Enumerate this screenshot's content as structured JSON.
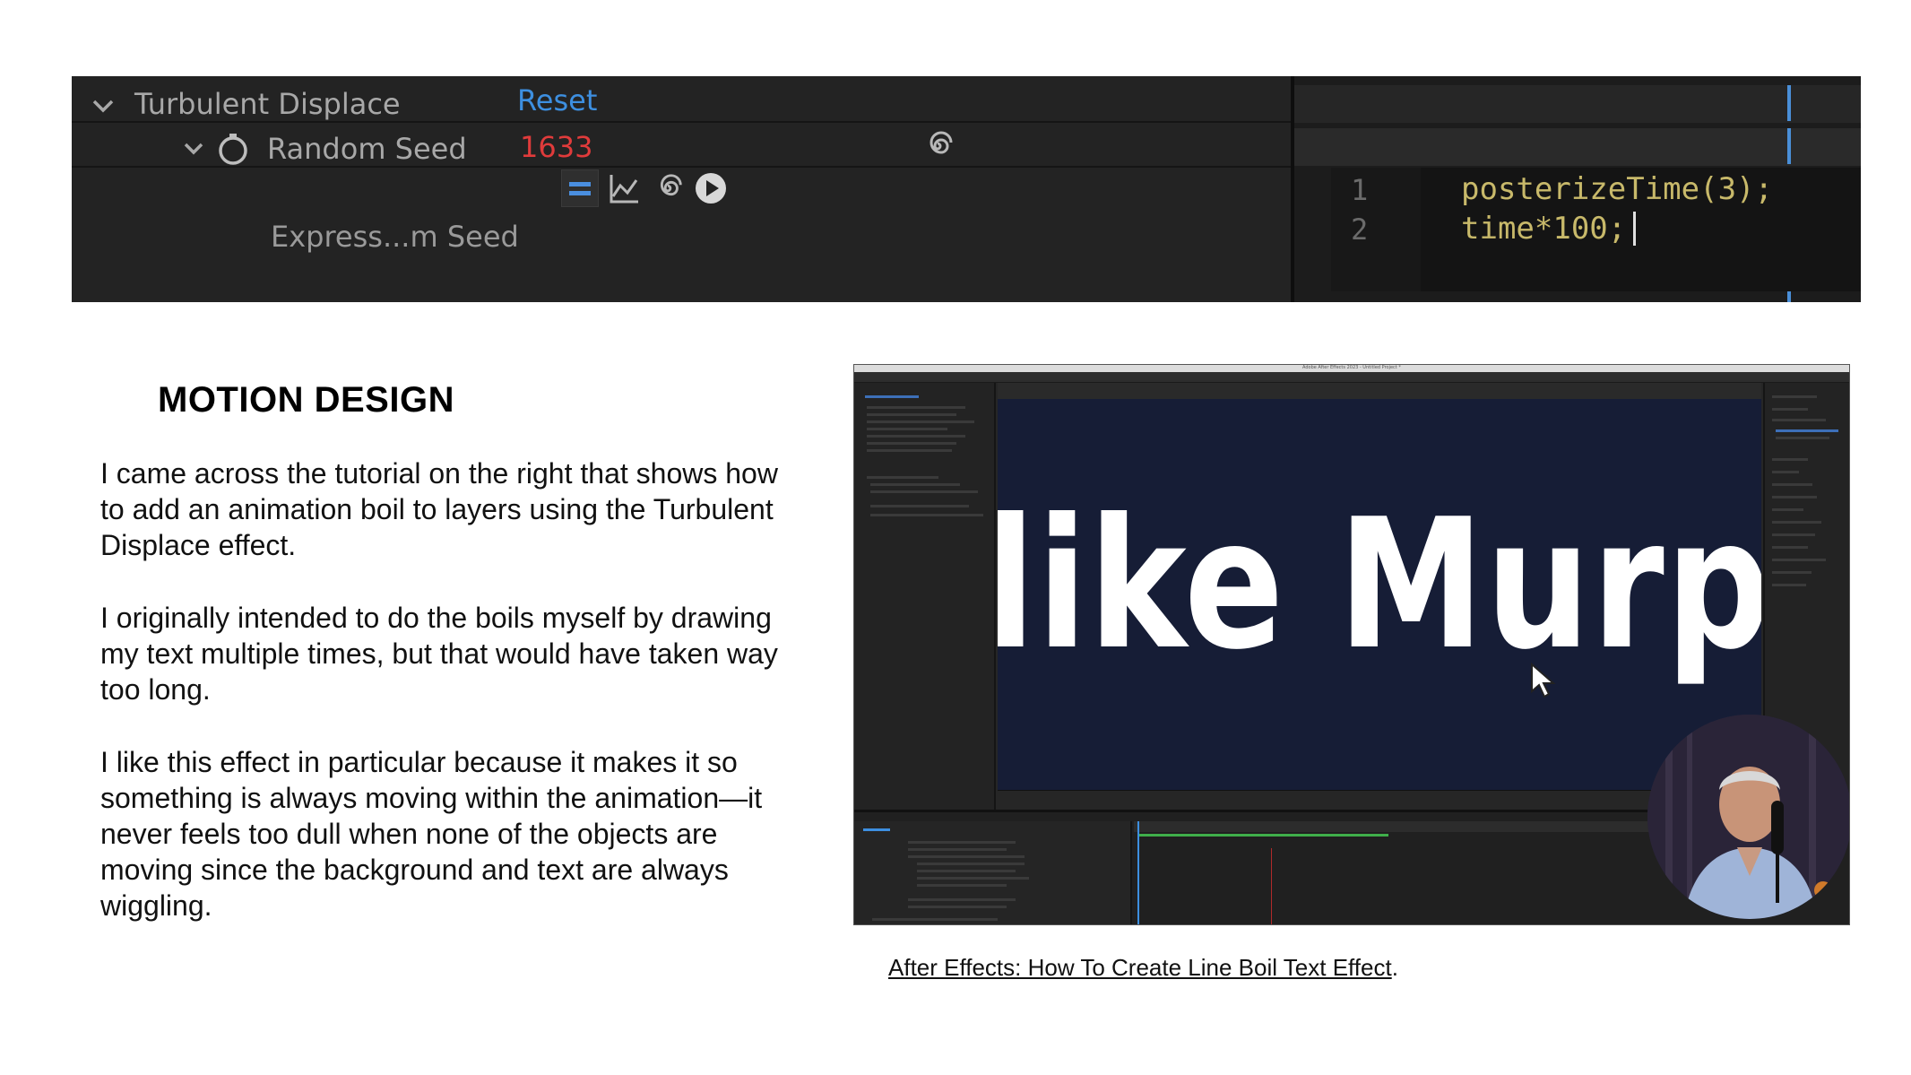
{
  "banner": {
    "effect_name": "Turbulent Displace",
    "reset_label": "Reset",
    "property_name": "Random Seed",
    "property_value": "1633",
    "expression_label": "Express...m Seed",
    "code_lines": [
      {
        "number": "1",
        "text": "posterizeTime(3);"
      },
      {
        "number": "2",
        "text": "time*100;"
      }
    ],
    "colors": {
      "reset": "#3d8fe0",
      "value": "#e03b3b",
      "code": "#c8b96a",
      "code_number": "#4aa8e8"
    },
    "icons": [
      "chevron-down-icon",
      "stopwatch-icon",
      "expression-equals-icon",
      "graph-icon",
      "pickwhip-spiral-icon",
      "play-circle-icon"
    ]
  },
  "article": {
    "heading": "MOTION DESIGN",
    "paragraphs": [
      "I came across the tutorial on the right that shows how to add an animation boil to layers using the Turbulent Displace effect.",
      "I originally intended to do the boils myself by drawing my text multiple times, but that would have taken way too long.",
      "I like this effect in particular because it makes it so something is always moving within the animation—it never feels too dull when none of the objects are moving since the background and text are always wiggling."
    ]
  },
  "video": {
    "window_title": "Adobe After Effects 2023 - Untitled Project *",
    "comp_text": "like Murphy",
    "colors": {
      "comp_background": "#161d36",
      "timeline_bar": "#3fae4a"
    }
  },
  "caption": {
    "link_text": "After Effects: How To Create Line Boil Text Effect",
    "trailing": "."
  }
}
